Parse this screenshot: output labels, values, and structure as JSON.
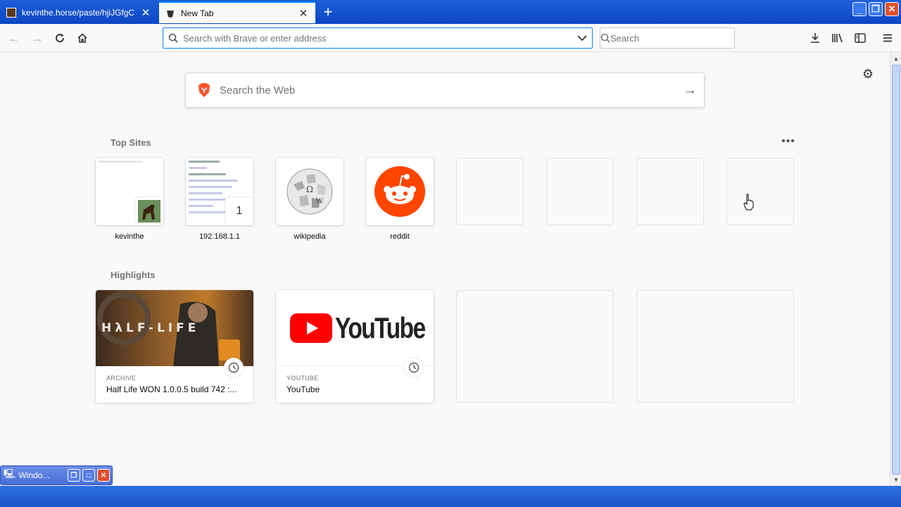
{
  "tabs": [
    {
      "label": "kevinthe.horse/paste/hjiJGfgC",
      "active": false
    },
    {
      "label": "New Tab",
      "active": true
    }
  ],
  "urlbar": {
    "placeholder": "Search with Brave or enter address"
  },
  "searchbar": {
    "placeholder": "Search"
  },
  "websearch": {
    "placeholder": "Search the Web"
  },
  "top_sites": {
    "title": "Top Sites",
    "items": [
      {
        "name": "kevinthe"
      },
      {
        "name": "192.168.1.1",
        "badge": "1"
      },
      {
        "name": "wikipedia"
      },
      {
        "name": "reddit"
      }
    ]
  },
  "highlights": {
    "title": "Highlights",
    "items": [
      {
        "source": "ARCHIVE",
        "title": "Half Life WON 1.0.0.5 build 742 :...",
        "thumb_text": "HλLF-LIFE"
      },
      {
        "source": "YOUTUBE",
        "title": "YouTube",
        "thumb_text": "YouTube"
      }
    ]
  },
  "taskbar": {
    "window_label": "Windo..."
  },
  "colors": {
    "accent": "#0a84ff",
    "reddit": "#ff4500",
    "youtube": "#ff0000",
    "brave": "#fb542b"
  }
}
